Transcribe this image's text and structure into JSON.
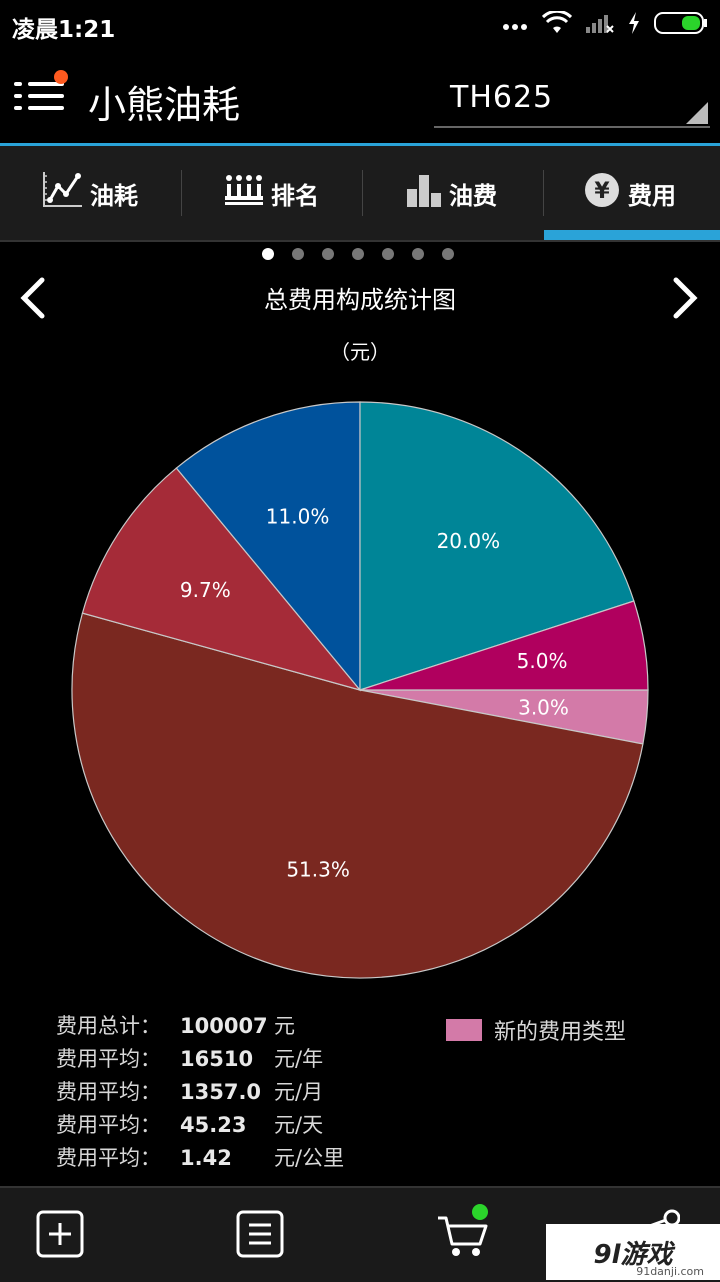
{
  "status": {
    "time": "凌晨1:21"
  },
  "app": {
    "title": "小熊油耗",
    "vehicle": "TH625"
  },
  "tabs": [
    {
      "label": "油耗",
      "icon": "line-chart-icon",
      "active": false
    },
    {
      "label": "排名",
      "icon": "crown-icon",
      "active": false
    },
    {
      "label": "油费",
      "icon": "bar-chart-icon",
      "active": false
    },
    {
      "label": "费用",
      "icon": "yen-icon",
      "active": true
    }
  ],
  "pager": {
    "count": 7,
    "active": 0
  },
  "chart": {
    "title": "总费用构成统计图",
    "unit": "（元）"
  },
  "chart_data": {
    "type": "pie",
    "title": "总费用构成统计图",
    "slices": [
      {
        "value": 3.0,
        "label": "3.0%",
        "color": "#d37aa8"
      },
      {
        "value": 51.3,
        "label": "51.3%",
        "color": "#7a2820"
      },
      {
        "value": 9.7,
        "label": "9.7%",
        "color": "#a52b38"
      },
      {
        "value": 11.0,
        "label": "11.0%",
        "color": "#00529c"
      },
      {
        "value": 20.0,
        "label": "20.0%",
        "color": "#008597"
      },
      {
        "value": 5.0,
        "label": "5.0%",
        "color": "#b0005e"
      }
    ],
    "start_angle_deg": 0,
    "direction": "clockwise",
    "legend": [
      {
        "label": "新的费用类型",
        "color": "#d37aa8"
      }
    ],
    "legend_position": "bottom-right"
  },
  "stats": [
    {
      "label": "费用总计：",
      "value": "100007",
      "unit": "元"
    },
    {
      "label": "费用平均：",
      "value": "16510",
      "unit": "元/年"
    },
    {
      "label": "费用平均：",
      "value": "1357.0",
      "unit": "元/月"
    },
    {
      "label": "费用平均：",
      "value": "45.23",
      "unit": "元/天"
    },
    {
      "label": "费用平均：",
      "value": "1.42",
      "unit": "元/公里"
    }
  ],
  "legend": {
    "label": "新的费用类型",
    "color": "#d37aa8"
  },
  "bottom": {
    "watermark_main": "9l游戏",
    "watermark_sub": "91danji.com"
  },
  "colors": {
    "accent": "#2aa3d8",
    "notification": "#ff5a1f",
    "cart_badge": "#2bd42b"
  }
}
